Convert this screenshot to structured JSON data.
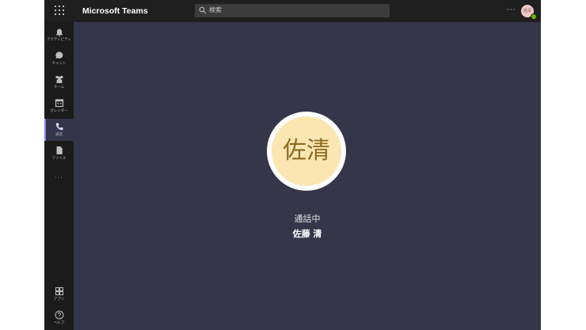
{
  "header": {
    "app_title": "Microsoft Teams",
    "search_placeholder": "検索",
    "more_label": "···",
    "user_avatar_initials": "佐清"
  },
  "rail": {
    "items": [
      {
        "label": "アクティビティ",
        "icon": "bell-icon"
      },
      {
        "label": "チャット",
        "icon": "chat-icon"
      },
      {
        "label": "チーム",
        "icon": "teams-icon"
      },
      {
        "label": "カレンダー",
        "icon": "calendar-icon"
      },
      {
        "label": "通話",
        "icon": "phone-icon",
        "active": true
      },
      {
        "label": "ファイル",
        "icon": "file-icon"
      }
    ],
    "more_label": "···",
    "bottom": [
      {
        "label": "アプリ",
        "icon": "apps-icon"
      },
      {
        "label": "ヘルプ",
        "icon": "help-icon"
      }
    ]
  },
  "call": {
    "avatar_initials": "佐清",
    "status": "通話中",
    "caller_name": "佐藤 清"
  },
  "colors": {
    "background": "#36364a",
    "rail": "#1b1b1b",
    "topbar": "#1f1f1f",
    "accent": "#7f85f5",
    "avatar_bg": "#fbe6b2",
    "avatar_text": "#8f6a20",
    "presence": "#6bb700"
  }
}
